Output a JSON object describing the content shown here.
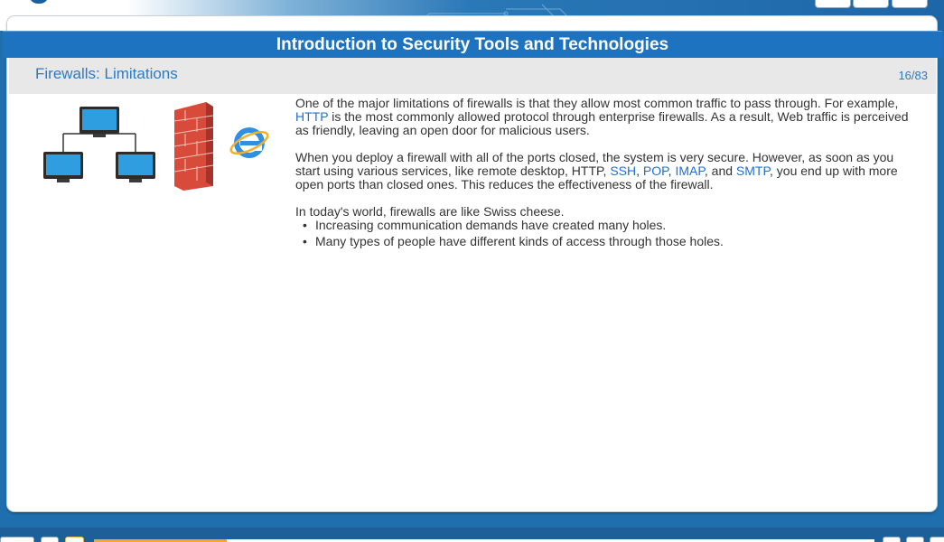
{
  "header": {
    "title": "Introduction to Security Tools and Technologies"
  },
  "slide": {
    "title": "Firewalls: Limitations",
    "counter": "16/83"
  },
  "body": {
    "p1_pre": "One of the major limitations of firewalls is that they allow most common traffic to pass through. For example, ",
    "p1_link": "HTTP",
    "p1_post": " is the most commonly allowed protocol through enterprise firewalls. As a result, Web traffic is perceived as friendly, leaving an open door for malicious users.",
    "p2_pre": "When you deploy a firewall with all of the ports closed, the system is very secure. However, as soon as you start using various services, like remote desktop, HTTP, ",
    "p2_links": [
      "SSH",
      "POP",
      "IMAP",
      "SMTP"
    ],
    "p2_sep1": ", ",
    "p2_sep2": ", ",
    "p2_and": ", and ",
    "p2_post": ", you end up with more open ports than closed ones. This reduces the effectiveness of the firewall.",
    "p3": "In today's world, firewalls are like Swiss cheese.",
    "bullet_char": "•",
    "bullets": [
      "Increasing communication demands have created many holes.",
      "Many types of people have different kinds of access through those holes."
    ]
  },
  "progress": {
    "fraction": 0.17
  },
  "colors": {
    "title_bar": "#1e73c1",
    "link": "#1f6fd6",
    "slide_title": "#2b7bc4",
    "progress": "#f2a830"
  },
  "icons": {
    "network": "network-diagram-icon",
    "firewall": "brick-wall-icon",
    "browser": "internet-explorer-icon"
  }
}
